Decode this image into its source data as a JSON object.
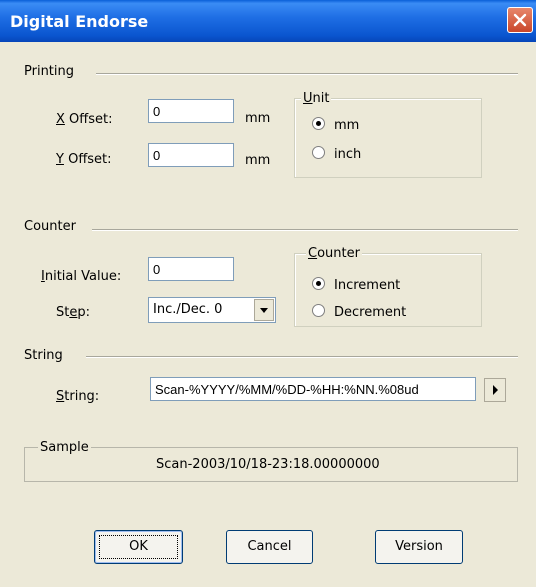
{
  "window": {
    "title": "Digital Endorse"
  },
  "printing": {
    "section_label": "Printing",
    "x_offset_label": "X Offset:",
    "x_offset_value": "0",
    "x_unit": "mm",
    "y_offset_label": "Y Offset:",
    "y_offset_value": "0",
    "y_unit": "mm",
    "unit_group_title": "Unit",
    "unit_options": [
      "mm",
      "inch"
    ],
    "unit_selected": "mm"
  },
  "counter": {
    "section_label": "Counter",
    "initial_label": "Initial Value:",
    "initial_value": "0",
    "step_label": "Step:",
    "step_value": "Inc./Dec. 0",
    "group_title": "Counter",
    "options": [
      "Increment",
      "Decrement"
    ],
    "selected": "Increment"
  },
  "string": {
    "section_label": "String",
    "field_label": "String:",
    "value": "Scan-%YYYY/%MM/%DD-%HH:%NN.%08ud"
  },
  "sample": {
    "title": "Sample",
    "value": "Scan-2003/10/18-23:18.00000000"
  },
  "buttons": {
    "ok": "OK",
    "cancel": "Cancel",
    "version": "Version"
  },
  "colors": {
    "titlebar": "#0a55cf",
    "dialog_bg": "#ece9d8",
    "close_button": "#c9462a"
  }
}
